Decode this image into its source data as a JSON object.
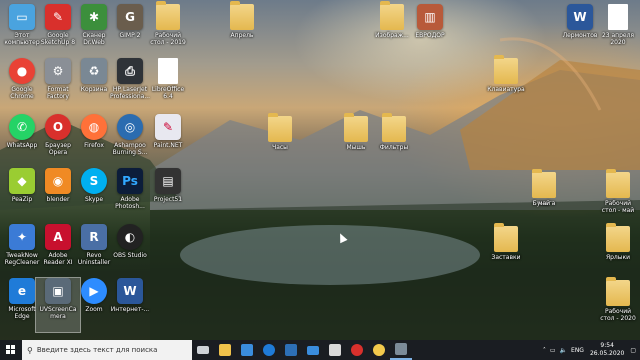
{
  "desktop": {
    "col1": [
      {
        "label": "Этот\nкомпьютер",
        "icon": "computer-icon",
        "color": "#4aa3df"
      },
      {
        "label": "Google\nChrome",
        "icon": "chrome-icon",
        "color": "#e94235"
      },
      {
        "label": "WhatsApp",
        "icon": "whatsapp-icon",
        "color": "#25d366"
      },
      {
        "label": "PeaZip",
        "icon": "peazip-icon",
        "color": "#9acd32"
      },
      {
        "label": "TweakNow\nRegCleaner",
        "icon": "regcleaner-icon",
        "color": "#3b7bd6"
      },
      {
        "label": "Microsoft\nEdge",
        "icon": "edge-icon",
        "color": "#1f7bd8"
      }
    ],
    "col2": [
      {
        "label": "Google\nSketchUp 8",
        "icon": "sketchup-icon",
        "color": "#d9302c"
      },
      {
        "label": "Format\nFactory",
        "icon": "formatfactory-icon",
        "color": "#8a8f96"
      },
      {
        "label": "Браузер\nOpera",
        "icon": "opera-icon",
        "color": "#d9302c"
      },
      {
        "label": "blender",
        "icon": "blender-icon",
        "color": "#f08a24"
      },
      {
        "label": "Adobe\nReader XI",
        "icon": "adobe-reader-icon",
        "color": "#c8102e"
      },
      {
        "label": "UVScreenCa\nmera",
        "icon": "uvscreencamera-icon",
        "color": "#5a6a78"
      }
    ],
    "col3": [
      {
        "label": "Сканер\nDr.Web",
        "icon": "drweb-icon",
        "color": "#3c8f3c"
      },
      {
        "label": "Корзина",
        "icon": "recycle-bin-icon",
        "color": "#7a8894"
      },
      {
        "label": "Firefox",
        "icon": "firefox-icon",
        "color": "#ff7139"
      },
      {
        "label": "Skype",
        "icon": "skype-icon",
        "color": "#00aff0"
      },
      {
        "label": "Revo\nUninstaller",
        "icon": "revo-icon",
        "color": "#4a6fa5"
      },
      {
        "label": "Zoom",
        "icon": "zoom-icon",
        "color": "#2d8cff"
      }
    ],
    "col4": [
      {
        "label": "GIMP 2",
        "icon": "gimp-icon",
        "color": "#6a5d4d"
      },
      {
        "label": "HP LaserJet\nProfessiona...",
        "icon": "printer-icon",
        "color": "#2f3338"
      },
      {
        "label": "Ashampoo\nBurning S...",
        "icon": "ashampoo-icon",
        "color": "#2b6cb0"
      },
      {
        "label": "Adobe\nPhotosh...",
        "icon": "photoshop-icon",
        "color": "#0c1d3a"
      },
      {
        "label": "OBS Studio",
        "icon": "obs-icon",
        "color": "#222"
      },
      {
        "label": "Интернет-...",
        "icon": "word-doc-icon",
        "color": "#2b579a"
      }
    ],
    "col5": [
      {
        "label": "Рабочий\nстол - 2019",
        "icon": "folder-icon"
      },
      {
        "label": "LibreOffice\n6.4",
        "icon": "libreoffice-icon"
      },
      {
        "label": "Paint.NET",
        "icon": "paintnet-icon"
      },
      {
        "label": "Project51",
        "icon": "video-file-icon"
      }
    ],
    "scattered": [
      {
        "label": "Апрель",
        "icon": "folder-icon"
      },
      {
        "label": "Изображ...",
        "icon": "folder-icon"
      },
      {
        "label": "ЕВРОДОР",
        "icon": "image-file-icon"
      },
      {
        "label": "Клавиатура",
        "icon": "folder-icon"
      },
      {
        "label": "Часы",
        "icon": "folder-icon"
      },
      {
        "label": "Мышь",
        "icon": "folder-icon"
      },
      {
        "label": "Фильтры",
        "icon": "folder-icon"
      },
      {
        "label": "Бумага",
        "icon": "folder-icon"
      },
      {
        "label": "Заставки",
        "icon": "folder-icon"
      }
    ],
    "right": [
      {
        "label": "Лермонтов",
        "icon": "word-doc-icon"
      },
      {
        "label": "23 апреля\n2020",
        "icon": "document-icon"
      },
      {
        "label": "май",
        "icon": "folder-icon"
      },
      {
        "label": "Рабочий\nстол - май",
        "icon": "folder-icon"
      },
      {
        "label": "Ярлыки",
        "icon": "folder-icon"
      },
      {
        "label": "Рабочий\nстол - 2020",
        "icon": "folder-icon"
      }
    ]
  },
  "taskbar": {
    "search_placeholder": "Введите здесь текст для поиска",
    "pinned": [
      {
        "icon": "task-view-icon",
        "color": "#cfd3d8"
      },
      {
        "icon": "file-explorer-icon",
        "color": "#f0c24b"
      },
      {
        "icon": "store-icon",
        "color": "#3a8dde"
      },
      {
        "icon": "edge-icon",
        "color": "#1f7bd8"
      },
      {
        "icon": "calculator-icon",
        "color": "#2d6fb6"
      },
      {
        "icon": "mail-icon",
        "color": "#3a8dde"
      },
      {
        "icon": "calendar-icon",
        "color": "#d9d9d9"
      },
      {
        "icon": "opera-icon",
        "color": "#d9302c"
      },
      {
        "icon": "yandex-icon",
        "color": "#f2c94c"
      },
      {
        "icon": "uvscreencamera-icon",
        "color": "#7c8b98"
      }
    ],
    "language": "ENG",
    "time": "9:54",
    "date": "26.05.2020"
  }
}
